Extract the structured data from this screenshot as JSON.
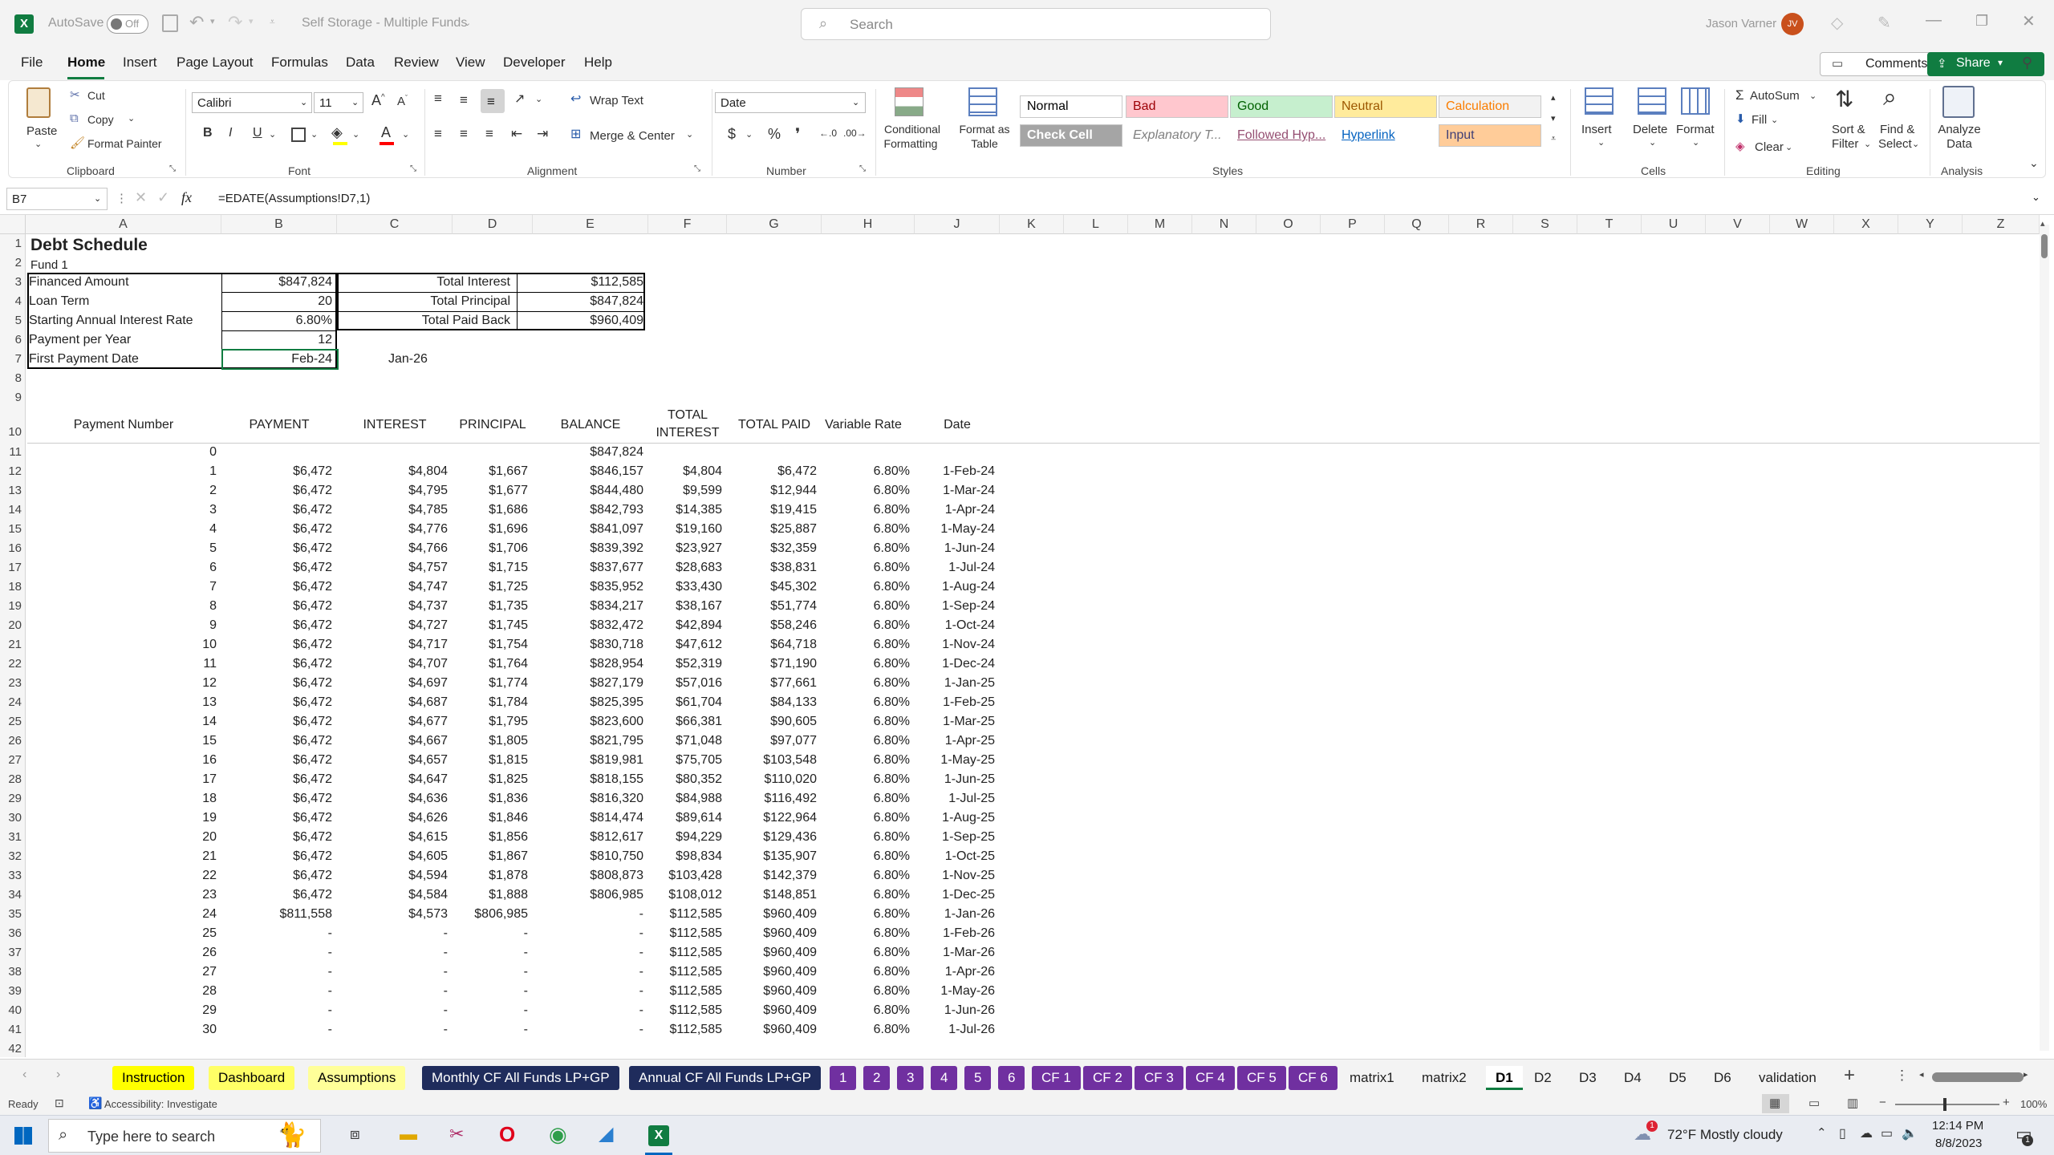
{
  "title": {
    "autosave": "AutoSave",
    "autosave_state": "Off",
    "filename": "Self Storage - Multiple Funds",
    "search_placeholder": "Search",
    "user": "Jason Varner",
    "initials": "JV"
  },
  "menu": [
    "File",
    "Home",
    "Insert",
    "Page Layout",
    "Formulas",
    "Data",
    "Review",
    "View",
    "Developer",
    "Help"
  ],
  "menu_right": {
    "comments": "Comments",
    "share": "Share"
  },
  "ribbon": {
    "paste": "Paste",
    "cut": "Cut",
    "copy": "Copy",
    "format_painter": "Format Painter",
    "clipboard": "Clipboard",
    "font_name": "Calibri",
    "font_size": "11",
    "font": "Font",
    "wrap_text": "Wrap Text",
    "merge_center": "Merge & Center",
    "alignment": "Alignment",
    "number_format": "Date",
    "number": "Number",
    "cond_fmt_1": "Conditional",
    "cond_fmt_2": "Formatting",
    "fmt_table_1": "Format as",
    "fmt_table_2": "Table",
    "styles_label": "Styles",
    "styles": [
      {
        "label": "Normal",
        "bg": "#ffffff",
        "fg": "#000000"
      },
      {
        "label": "Bad",
        "bg": "#ffc7ce",
        "fg": "#9c0006"
      },
      {
        "label": "Good",
        "bg": "#c6efce",
        "fg": "#006100"
      },
      {
        "label": "Neutral",
        "bg": "#ffeb9c",
        "fg": "#9c5700"
      },
      {
        "label": "Calculation",
        "bg": "#f2f2f2",
        "fg": "#fa7d00"
      },
      {
        "label": "Check Cell",
        "bg": "#a5a5a5",
        "fg": "#ffffff"
      },
      {
        "label": "Explanatory T...",
        "bg": "#ffffff",
        "fg": "#7f7f7f"
      },
      {
        "label": "Followed Hyp...",
        "bg": "#ffffff",
        "fg": "#954f72"
      },
      {
        "label": "Hyperlink",
        "bg": "#ffffff",
        "fg": "#0563c1"
      },
      {
        "label": "Input",
        "bg": "#ffcc99",
        "fg": "#3f3f76"
      }
    ],
    "insert": "Insert",
    "delete": "Delete",
    "format": "Format",
    "cells": "Cells",
    "autosum": "AutoSum",
    "fill": "Fill",
    "clear": "Clear",
    "sort_1": "Sort &",
    "sort_2": "Filter",
    "find_1": "Find &",
    "find_2": "Select",
    "editing": "Editing",
    "analyze_1": "Analyze",
    "analyze_2": "Data",
    "analysis": "Analysis"
  },
  "formula": {
    "namebox": "B7",
    "fx": "fx",
    "formula": "=EDATE(Assumptions!D7,1)"
  },
  "columns": [
    "A",
    "B",
    "C",
    "D",
    "E",
    "F",
    "G",
    "H",
    "J",
    "K",
    "L",
    "M",
    "N",
    "O",
    "P",
    "Q",
    "R",
    "S",
    "T",
    "U",
    "V",
    "W",
    "X",
    "Y",
    "Z"
  ],
  "sheet": {
    "title": "Debt Schedule",
    "subtitle": "Fund 1",
    "inputs": [
      {
        "label": "Financed Amount",
        "value": "$847,824"
      },
      {
        "label": "Loan Term",
        "value": "20"
      },
      {
        "label": "Starting Annual Interest Rate",
        "value": "6.80%"
      },
      {
        "label": "Payment per Year",
        "value": "12"
      },
      {
        "label": "First Payment Date",
        "value": "Feb-24"
      }
    ],
    "totals": [
      {
        "label": "Total Interest",
        "value": "$112,585"
      },
      {
        "label": "Total Principal",
        "value": "$847,824"
      },
      {
        "label": "Total Paid Back",
        "value": "$960,409"
      }
    ],
    "c7": "Jan-26",
    "headers": [
      "Payment Number",
      "PAYMENT",
      "INTEREST",
      "PRINCIPAL",
      "BALANCE",
      "TOTAL",
      "INTEREST",
      "TOTAL PAID",
      "Variable  Rate",
      "Date"
    ],
    "row11": {
      "num": "0",
      "balance": "$847,824"
    },
    "rows": [
      [
        "1",
        "$6,472",
        "$4,804",
        "$1,667",
        "$846,157",
        "$4,804",
        "$6,472",
        "6.80%",
        "1-Feb-24"
      ],
      [
        "2",
        "$6,472",
        "$4,795",
        "$1,677",
        "$844,480",
        "$9,599",
        "$12,944",
        "6.80%",
        "1-Mar-24"
      ],
      [
        "3",
        "$6,472",
        "$4,785",
        "$1,686",
        "$842,793",
        "$14,385",
        "$19,415",
        "6.80%",
        "1-Apr-24"
      ],
      [
        "4",
        "$6,472",
        "$4,776",
        "$1,696",
        "$841,097",
        "$19,160",
        "$25,887",
        "6.80%",
        "1-May-24"
      ],
      [
        "5",
        "$6,472",
        "$4,766",
        "$1,706",
        "$839,392",
        "$23,927",
        "$32,359",
        "6.80%",
        "1-Jun-24"
      ],
      [
        "6",
        "$6,472",
        "$4,757",
        "$1,715",
        "$837,677",
        "$28,683",
        "$38,831",
        "6.80%",
        "1-Jul-24"
      ],
      [
        "7",
        "$6,472",
        "$4,747",
        "$1,725",
        "$835,952",
        "$33,430",
        "$45,302",
        "6.80%",
        "1-Aug-24"
      ],
      [
        "8",
        "$6,472",
        "$4,737",
        "$1,735",
        "$834,217",
        "$38,167",
        "$51,774",
        "6.80%",
        "1-Sep-24"
      ],
      [
        "9",
        "$6,472",
        "$4,727",
        "$1,745",
        "$832,472",
        "$42,894",
        "$58,246",
        "6.80%",
        "1-Oct-24"
      ],
      [
        "10",
        "$6,472",
        "$4,717",
        "$1,754",
        "$830,718",
        "$47,612",
        "$64,718",
        "6.80%",
        "1-Nov-24"
      ],
      [
        "11",
        "$6,472",
        "$4,707",
        "$1,764",
        "$828,954",
        "$52,319",
        "$71,190",
        "6.80%",
        "1-Dec-24"
      ],
      [
        "12",
        "$6,472",
        "$4,697",
        "$1,774",
        "$827,179",
        "$57,016",
        "$77,661",
        "6.80%",
        "1-Jan-25"
      ],
      [
        "13",
        "$6,472",
        "$4,687",
        "$1,784",
        "$825,395",
        "$61,704",
        "$84,133",
        "6.80%",
        "1-Feb-25"
      ],
      [
        "14",
        "$6,472",
        "$4,677",
        "$1,795",
        "$823,600",
        "$66,381",
        "$90,605",
        "6.80%",
        "1-Mar-25"
      ],
      [
        "15",
        "$6,472",
        "$4,667",
        "$1,805",
        "$821,795",
        "$71,048",
        "$97,077",
        "6.80%",
        "1-Apr-25"
      ],
      [
        "16",
        "$6,472",
        "$4,657",
        "$1,815",
        "$819,981",
        "$75,705",
        "$103,548",
        "6.80%",
        "1-May-25"
      ],
      [
        "17",
        "$6,472",
        "$4,647",
        "$1,825",
        "$818,155",
        "$80,352",
        "$110,020",
        "6.80%",
        "1-Jun-25"
      ],
      [
        "18",
        "$6,472",
        "$4,636",
        "$1,836",
        "$816,320",
        "$84,988",
        "$116,492",
        "6.80%",
        "1-Jul-25"
      ],
      [
        "19",
        "$6,472",
        "$4,626",
        "$1,846",
        "$814,474",
        "$89,614",
        "$122,964",
        "6.80%",
        "1-Aug-25"
      ],
      [
        "20",
        "$6,472",
        "$4,615",
        "$1,856",
        "$812,617",
        "$94,229",
        "$129,436",
        "6.80%",
        "1-Sep-25"
      ],
      [
        "21",
        "$6,472",
        "$4,605",
        "$1,867",
        "$810,750",
        "$98,834",
        "$135,907",
        "6.80%",
        "1-Oct-25"
      ],
      [
        "22",
        "$6,472",
        "$4,594",
        "$1,878",
        "$808,873",
        "$103,428",
        "$142,379",
        "6.80%",
        "1-Nov-25"
      ],
      [
        "23",
        "$6,472",
        "$4,584",
        "$1,888",
        "$806,985",
        "$108,012",
        "$148,851",
        "6.80%",
        "1-Dec-25"
      ],
      [
        "24",
        "$811,558",
        "$4,573",
        "$806,985",
        "-",
        "$112,585",
        "$960,409",
        "6.80%",
        "1-Jan-26"
      ],
      [
        "25",
        "-",
        "-",
        "-",
        "-",
        "$112,585",
        "$960,409",
        "6.80%",
        "1-Feb-26"
      ],
      [
        "26",
        "-",
        "-",
        "-",
        "-",
        "$112,585",
        "$960,409",
        "6.80%",
        "1-Mar-26"
      ],
      [
        "27",
        "-",
        "-",
        "-",
        "-",
        "$112,585",
        "$960,409",
        "6.80%",
        "1-Apr-26"
      ],
      [
        "28",
        "-",
        "-",
        "-",
        "-",
        "$112,585",
        "$960,409",
        "6.80%",
        "1-May-26"
      ],
      [
        "29",
        "-",
        "-",
        "-",
        "-",
        "$112,585",
        "$960,409",
        "6.80%",
        "1-Jun-26"
      ],
      [
        "30",
        "-",
        "-",
        "-",
        "-",
        "$112,585",
        "$960,409",
        "6.80%",
        "1-Jul-26"
      ]
    ]
  },
  "tabs": [
    {
      "label": "Instruction",
      "bg": "#ffff00",
      "fg": "#000000"
    },
    {
      "label": "Dashboard",
      "bg": "#ffff66",
      "fg": "#000000"
    },
    {
      "label": "Assumptions",
      "bg": "#ffff99",
      "fg": "#000000"
    },
    {
      "label": "Monthly CF All Funds LP+GP",
      "bg": "#1f2c5c",
      "fg": "#ffffff"
    },
    {
      "label": "Annual CF All Funds LP+GP",
      "bg": "#1f2c5c",
      "fg": "#ffffff"
    },
    {
      "label": "1",
      "bg": "#7030a0",
      "fg": "#ffffff"
    },
    {
      "label": "2",
      "bg": "#7030a0",
      "fg": "#ffffff"
    },
    {
      "label": "3",
      "bg": "#7030a0",
      "fg": "#ffffff"
    },
    {
      "label": "4",
      "bg": "#7030a0",
      "fg": "#ffffff"
    },
    {
      "label": "5",
      "bg": "#7030a0",
      "fg": "#ffffff"
    },
    {
      "label": "6",
      "bg": "#7030a0",
      "fg": "#ffffff"
    },
    {
      "label": "CF 1",
      "bg": "#7030a0",
      "fg": "#ffffff"
    },
    {
      "label": "CF 2",
      "bg": "#7030a0",
      "fg": "#ffffff"
    },
    {
      "label": "CF 3",
      "bg": "#7030a0",
      "fg": "#ffffff"
    },
    {
      "label": "CF 4",
      "bg": "#7030a0",
      "fg": "#ffffff"
    },
    {
      "label": "CF 5",
      "bg": "#7030a0",
      "fg": "#ffffff"
    },
    {
      "label": "CF 6",
      "bg": "#7030a0",
      "fg": "#ffffff"
    },
    {
      "label": "matrix1",
      "bg": "",
      "fg": "#222222"
    },
    {
      "label": "matrix2",
      "bg": "",
      "fg": "#222222"
    },
    {
      "label": "D1",
      "bg": "#ffffff",
      "fg": "#000000"
    },
    {
      "label": "D2",
      "bg": "",
      "fg": "#222222"
    },
    {
      "label": "D3",
      "bg": "",
      "fg": "#222222"
    },
    {
      "label": "D4",
      "bg": "",
      "fg": "#222222"
    },
    {
      "label": "D5",
      "bg": "",
      "fg": "#222222"
    },
    {
      "label": "D6",
      "bg": "",
      "fg": "#222222"
    },
    {
      "label": "validation",
      "bg": "",
      "fg": "#222222"
    }
  ],
  "status": {
    "ready": "Ready",
    "accessibility": "Accessibility: Investigate",
    "zoom": "100%"
  },
  "taskbar": {
    "search": "Type here to search",
    "weather": "72°F  Mostly cloudy",
    "time": "12:14 PM",
    "date": "8/8/2023",
    "notif": "1"
  }
}
